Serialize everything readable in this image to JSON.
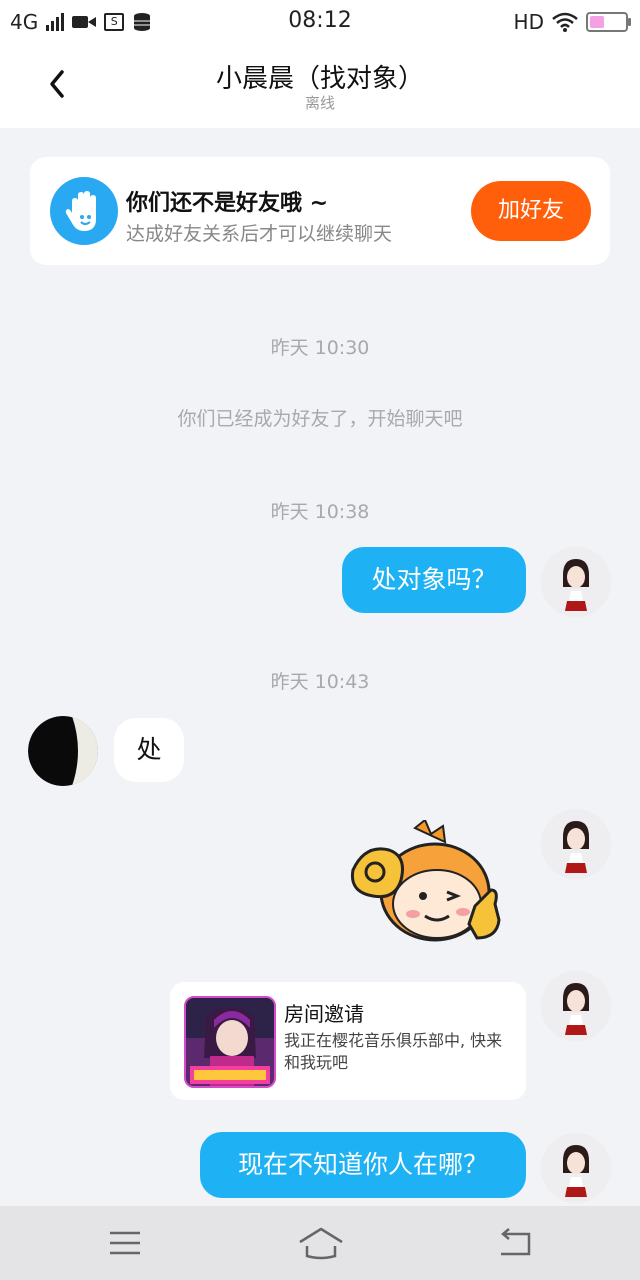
{
  "status_bar": {
    "network": "4G",
    "time": "08:12",
    "hd": "HD",
    "battery_level": 0.4
  },
  "header": {
    "title": "小晨晨（找对象）",
    "subtitle": "离线"
  },
  "friend_card": {
    "title": "你们还不是好友哦 ~",
    "description": "达成好友关系后才可以继续聊天",
    "button": "加好友"
  },
  "messages": {
    "time1": "昨天 10:30",
    "system": "你们已经成为好友了，开始聊天吧",
    "time2": "昨天 10:38",
    "msg1": "处对象吗？",
    "time3": "昨天 10:43",
    "msg2": "处",
    "invite": {
      "title": "房间邀请",
      "description": "我正在樱花音乐俱乐部中, 快来和我玩吧"
    },
    "msg3": "现在不知道你人在哪？"
  },
  "colors": {
    "accent_blue": "#1eb2f4",
    "add_button": "#ff5e0a",
    "background": "#f2f3f7"
  }
}
